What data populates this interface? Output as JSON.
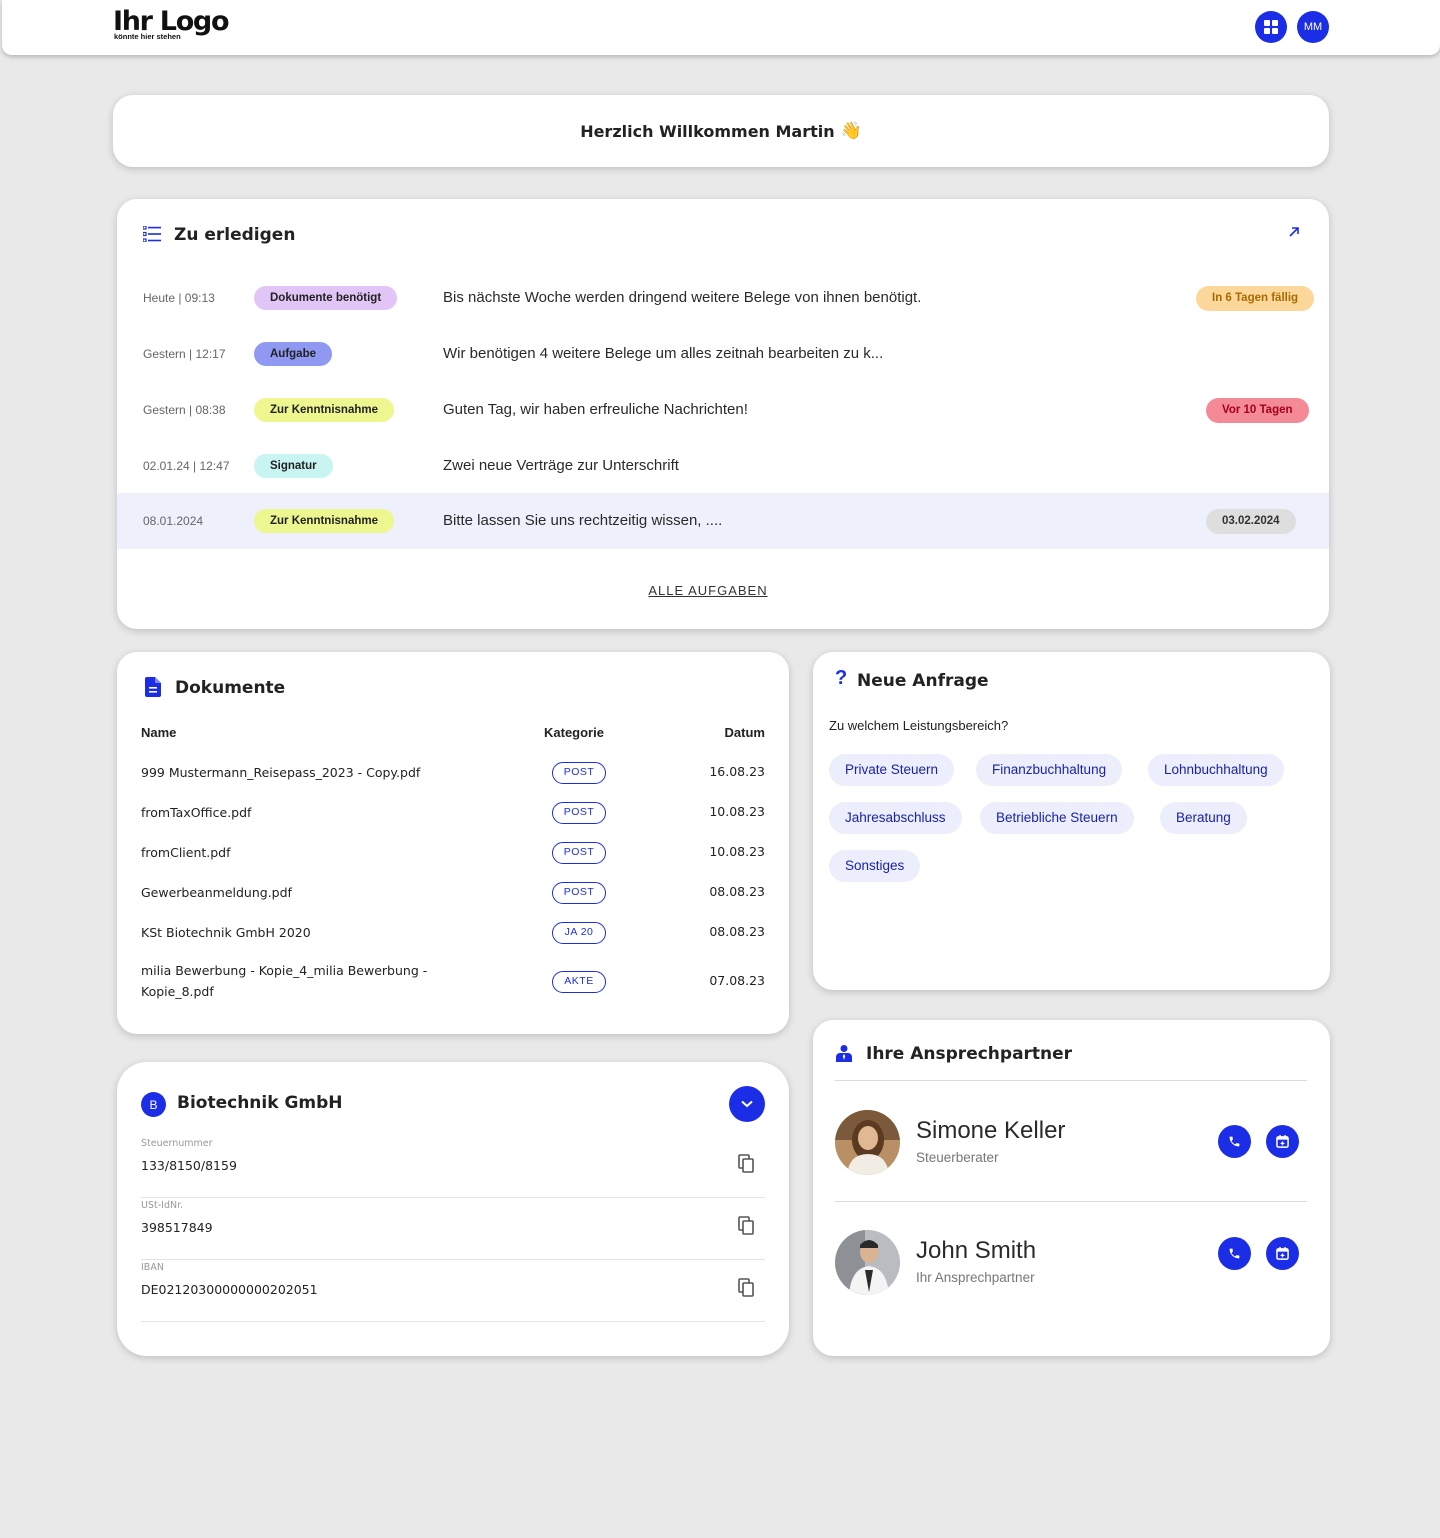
{
  "header": {
    "logo_main": "Ihr Logo",
    "logo_sub": "könnte hier stehen",
    "user_initials": "MM"
  },
  "welcome": {
    "text": "Herzlich Willkommen Martin",
    "emoji": "👋"
  },
  "tasks": {
    "title": "Zu erledigen",
    "items": [
      {
        "time": "Heute | 09:13",
        "tag": "Dokumente benötigt",
        "text": "Bis nächste Woche werden dringend weitere Belege von ihnen benötigt.",
        "badge": "In 6 Tagen fällig"
      },
      {
        "time": "Gestern | 12:17",
        "tag": "Aufgabe",
        "text": "Wir benötigen 4 weitere Belege um alles zeitnah bearbeiten zu k...",
        "badge": ""
      },
      {
        "time": "Gestern | 08:38",
        "tag": "Zur Kenntnisnahme",
        "text": "Guten Tag, wir haben erfreuliche Nachrichten!",
        "badge": "Vor 10 Tagen"
      },
      {
        "time": "02.01.24 | 12:47",
        "tag": "Signatur",
        "text": "Zwei neue Verträge zur Unterschrift",
        "badge": ""
      },
      {
        "time": "08.01.2024",
        "tag": "Zur Kenntnisnahme",
        "text": "Bitte lassen Sie uns rechtzeitig wissen, ....",
        "badge": "03.02.2024"
      }
    ],
    "all_link": "ALLE AUFGABEN"
  },
  "documents": {
    "title": "Dokumente",
    "columns": {
      "name": "Name",
      "category": "Kategorie",
      "date": "Datum"
    },
    "rows": [
      {
        "name": "999 Mustermann_Reisepass_2023 - Copy.pdf",
        "category": "POST",
        "date": "16.08.23"
      },
      {
        "name": "fromTaxOffice.pdf",
        "category": "POST",
        "date": "10.08.23"
      },
      {
        "name": "fromClient.pdf",
        "category": "POST",
        "date": "10.08.23"
      },
      {
        "name": "Gewerbeanmeldung.pdf",
        "category": "POST",
        "date": "08.08.23"
      },
      {
        "name": "KSt Biotechnik GmbH 2020",
        "category": "JA 20",
        "date": "08.08.23"
      },
      {
        "name": "milia Bewerbung - Kopie_4_milia Bewerbung - Kopie_8.pdf",
        "category": "AKTE",
        "date": "07.08.23"
      }
    ]
  },
  "company": {
    "initial": "B",
    "name": "Biotechnik GmbH",
    "fields": [
      {
        "label": "Steuernummer",
        "value": "133/8150/8159"
      },
      {
        "label": "USt-IdNr.",
        "value": "398517849"
      },
      {
        "label": "IBAN",
        "value": "DE02120300000000202051"
      }
    ]
  },
  "inquiry": {
    "title": "Neue Anfrage",
    "question": "Zu welchem Leistungsbereich?",
    "options": [
      "Private Steuern",
      "Finanzbuchhaltung",
      "Lohnbuchhaltung",
      "Jahresabschluss",
      "Betriebliche Steuern",
      "Beratung",
      "Sonstiges"
    ]
  },
  "contacts": {
    "title": "Ihre Ansprechpartner",
    "people": [
      {
        "name": "Simone Keller",
        "role": "Steuerberater"
      },
      {
        "name": "John Smith",
        "role": "Ihr Ansprechpartner"
      }
    ]
  },
  "colors": {
    "accent": "#1b2ee6",
    "tag_documents": "#e2c5f7",
    "tag_task": "#8f99f2",
    "tag_notice": "#eef78f",
    "tag_signature": "#c8f4f2",
    "badge_due": "#fbd89a",
    "badge_overdue": "#f48a96",
    "badge_date": "#dedede"
  },
  "icons": [
    "grid-icon",
    "list-icon",
    "arrow-up-right-icon",
    "document-icon",
    "chevron-down-icon",
    "copy-icon",
    "question-icon",
    "contact-person-icon",
    "phone-icon",
    "calendar-icon"
  ]
}
